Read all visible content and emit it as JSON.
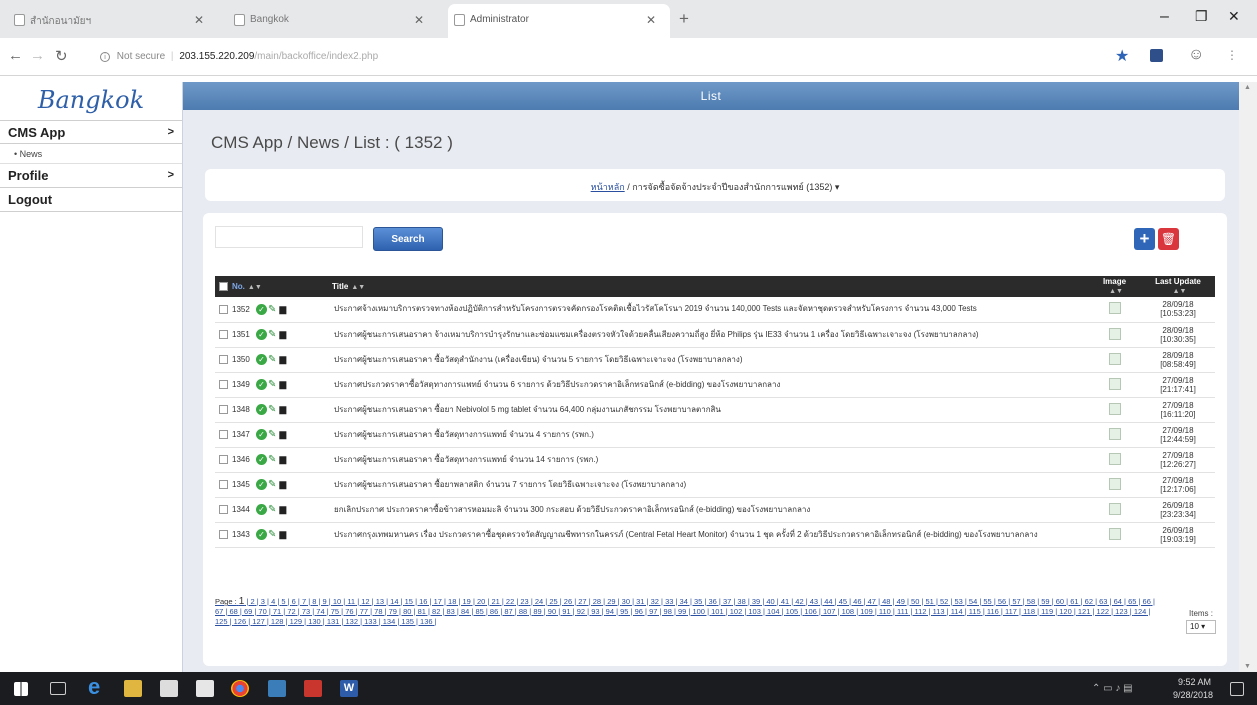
{
  "browser": {
    "tabs": [
      {
        "label": "สำนักอนามัยฯ"
      },
      {
        "label": "Bangkok"
      },
      {
        "label": "Administrator"
      }
    ],
    "new_tab": "+",
    "window_controls": {
      "minimize": "–",
      "restore": "❐",
      "close": "✕"
    },
    "address": {
      "security": "Not secure",
      "host": "203.155.220.209",
      "path": "/main/backoffice/index2.php"
    }
  },
  "sidebar": {
    "logo": "Bangkok",
    "menu": [
      {
        "label": "CMS App",
        "arrow": ">",
        "sub": [
          "• News"
        ]
      },
      {
        "label": "Profile",
        "arrow": ">",
        "sub": []
      },
      {
        "label": "Logout",
        "arrow": "",
        "sub": []
      }
    ]
  },
  "main": {
    "banner": "List",
    "title": "CMS App / News / List : ( 1352 )",
    "breadcrumb": {
      "link": "หน้าหลัก",
      "sep": " / ",
      "current": "การจัดซื้อจัดจ้างประจำปีของสำนักการแพทย์ (1352) ▾"
    },
    "search": {
      "placeholder": "",
      "button": "Search"
    },
    "add_button": "+",
    "delete_button": "🗑"
  },
  "table": {
    "headers": {
      "no": "No.",
      "title": "Title",
      "image": "Image",
      "updated": "Last Update"
    },
    "rows": [
      {
        "no": "1352",
        "title": "ประกาศจ้างเหมาบริการตรวจทางห้องปฏิบัติการสำหรับโครงการตรวจคัดกรองโรคติดเชื้อไวรัสโคโรนา 2019 จำนวน 140,000 Tests และจัดหาชุดตรวจสำหรับโครงการ จำนวน 43,000 Tests",
        "date": "28/09/18",
        "time": "[10:53:23]"
      },
      {
        "no": "1351",
        "title": "ประกาศผู้ชนะการเสนอราคา จ้างเหมาบริการบำรุงรักษาและซ่อมแซมเครื่องตรวจหัวใจด้วยคลื่นเสียงความถี่สูง ยี่ห้อ Philips รุ่น IE33 จำนวน 1 เครื่อง โดยวิธีเฉพาะเจาะจง (โรงพยาบาลกลาง)",
        "date": "28/09/18",
        "time": "[10:30:35]"
      },
      {
        "no": "1350",
        "title": "ประกาศผู้ชนะการเสนอราคา ซื้อวัสดุสำนักงาน (เครื่องเขียน) จำนวน 5 รายการ โดยวิธีเฉพาะเจาะจง (โรงพยาบาลกลาง)",
        "date": "28/09/18",
        "time": "[08:58:49]"
      },
      {
        "no": "1349",
        "title": "ประกาศประกวดราคาซื้อวัสดุทางการแพทย์ จำนวน 6 รายการ ด้วยวิธีประกวดราคาอิเล็กทรอนิกส์ (e-bidding) ของโรงพยาบาลกลาง",
        "date": "27/09/18",
        "time": "[21:17:41]"
      },
      {
        "no": "1348",
        "title": "ประกาศผู้ชนะการเสนอราคา ซื้อยา Nebivolol 5 mg tablet จำนวน 64,400 กลุ่มงานเภสัชกรรม โรงพยาบาลตากสิน",
        "date": "27/09/18",
        "time": "[16:11:20]"
      },
      {
        "no": "1347",
        "title": "ประกาศผู้ชนะการเสนอราคา ซื้อวัสดุทางการแพทย์ จำนวน 4 รายการ (รพก.)",
        "date": "27/09/18",
        "time": "[12:44:59]"
      },
      {
        "no": "1346",
        "title": "ประกาศผู้ชนะการเสนอราคา ซื้อวัสดุทางการแพทย์ จำนวน 14 รายการ (รพก.)",
        "date": "27/09/18",
        "time": "[12:26:27]"
      },
      {
        "no": "1345",
        "title": "ประกาศผู้ชนะการเสนอราคา ซื้อยาพลาสติก จำนวน 7 รายการ โดยวิธีเฉพาะเจาะจง (โรงพยาบาลกลาง)",
        "date": "27/09/18",
        "time": "[12:17:06]"
      },
      {
        "no": "1344",
        "title": "ยกเลิกประกาศ ประกวดราคาซื้อข้าวสารหอมมะลิ จำนวน 300 กระสอบ ด้วยวิธีประกวดราคาอิเล็กทรอนิกส์ (e-bidding) ของโรงพยาบาลกลาง",
        "date": "26/09/18",
        "time": "[23:23:34]"
      },
      {
        "no": "1343",
        "title": "ประกาศกรุงเทพมหานคร เรื่อง ประกวดราคาซื้อชุดตรวจวัดสัญญาณชีพทารกในครรภ์ (Central Fetal Heart Monitor) จำนวน 1 ชุด ครั้งที่ 2 ด้วยวิธีประกวดราคาอิเล็กทรอนิกส์ (e-bidding) ของโรงพยาบาลกลาง",
        "date": "26/09/18",
        "time": "[19:03:19]"
      }
    ]
  },
  "pager": {
    "label": "Page :",
    "current": "1",
    "pages": [
      "2",
      "3",
      "4",
      "5",
      "6",
      "7",
      "8",
      "9",
      "10",
      "11",
      "12",
      "13",
      "14",
      "15",
      "16",
      "17",
      "18",
      "19",
      "20",
      "21",
      "22",
      "23",
      "24",
      "25",
      "26",
      "27",
      "28",
      "29",
      "30",
      "31",
      "32",
      "33",
      "34",
      "35",
      "36",
      "37",
      "38",
      "39",
      "40",
      "41",
      "42",
      "43",
      "44",
      "45",
      "46",
      "47",
      "48",
      "49",
      "50",
      "51",
      "52",
      "53",
      "54",
      "55",
      "56",
      "57",
      "58",
      "59",
      "60",
      "61",
      "62",
      "63",
      "64",
      "65",
      "66",
      "67",
      "68",
      "69",
      "70",
      "71",
      "72",
      "73",
      "74",
      "75",
      "76",
      "77",
      "78",
      "79",
      "80",
      "81",
      "82",
      "83",
      "84",
      "85",
      "86",
      "87",
      "88",
      "89",
      "90",
      "91",
      "92",
      "93",
      "94",
      "95",
      "96",
      "97",
      "98",
      "99",
      "100",
      "101",
      "102",
      "103",
      "104",
      "105",
      "106",
      "107",
      "108",
      "109",
      "110",
      "111",
      "112",
      "113",
      "114",
      "115",
      "116",
      "117",
      "118",
      "119",
      "120",
      "121",
      "122",
      "123",
      "124",
      "125",
      "126",
      "127",
      "128",
      "129",
      "130",
      "131",
      "132",
      "133",
      "134",
      "135",
      "136"
    ],
    "items_label": "Items :",
    "items_value": "10 ▾"
  },
  "taskbar": {
    "time": "9:52 AM",
    "date": "9/28/2018"
  }
}
